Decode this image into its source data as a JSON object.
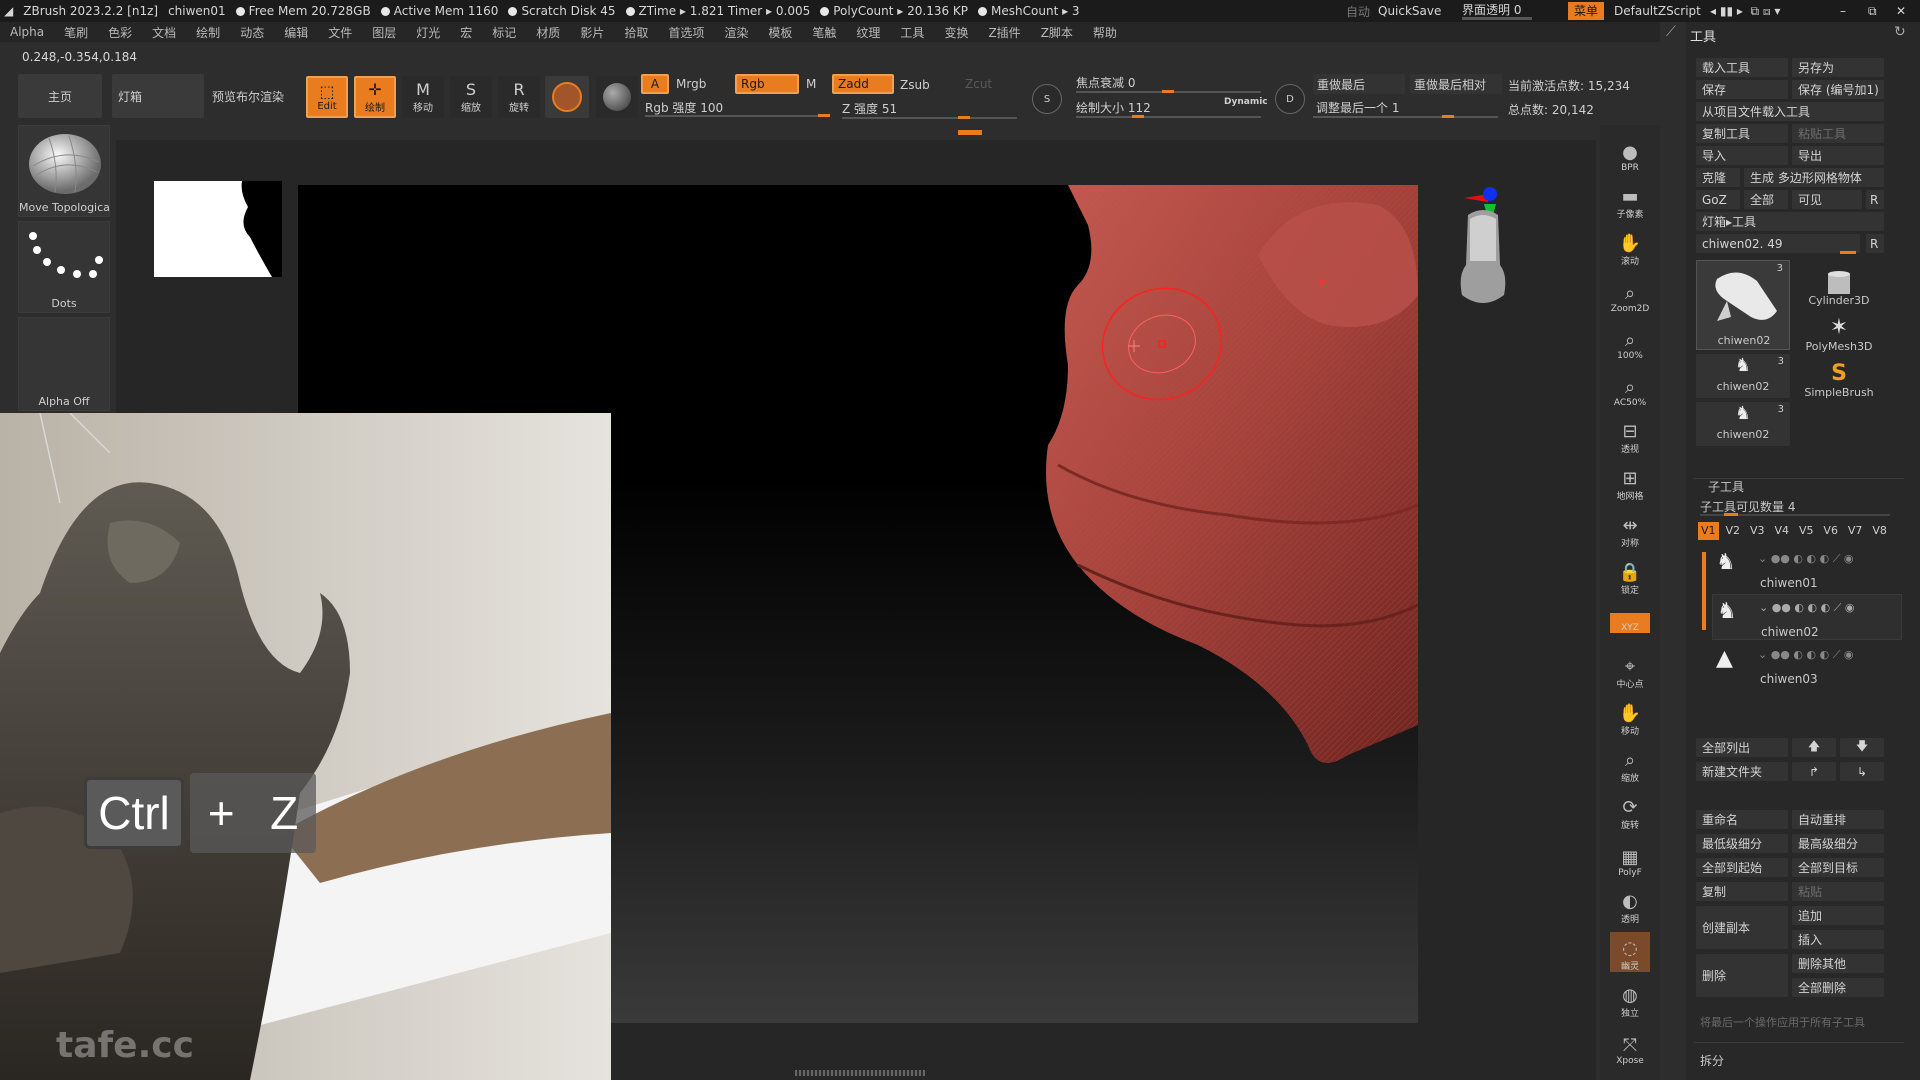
{
  "titlebar": {
    "app": "ZBrush 2023.2.2 [n1z]",
    "document": "chiwen01",
    "free_mem": "Free Mem 20.728GB",
    "active_mem": "Active Mem 1160",
    "scratch": "Scratch Disk 45",
    "ztime": "ZTime ▸ 1.821 Timer ▸ 0.005",
    "polycount": "PolyCount ▸ 20.136 KP",
    "meshcount": "MeshCount ▸ 3",
    "auto": "自动",
    "quicksave": "QuickSave",
    "ui_transparency": "界面透明 0",
    "menu_btn": "菜单",
    "zscript": "DefaultZScript"
  },
  "menubar": [
    "Alpha",
    "笔刷",
    "色彩",
    "文档",
    "绘制",
    "动态",
    "编辑",
    "文件",
    "图层",
    "灯光",
    "宏",
    "标记",
    "材质",
    "影片",
    "拾取",
    "首选项",
    "渲染",
    "模板",
    "笔触",
    "纹理",
    "工具",
    "变换",
    "Z插件",
    "Z脚本",
    "帮助"
  ],
  "coords": "0.248,-0.354,0.184",
  "toolbar": {
    "home": "主页",
    "lightbox": "灯箱",
    "bpr_preview": "预览布尔渲染",
    "edit": "Edit",
    "draw": "绘制",
    "move": "移动",
    "scale": "缩放",
    "rotate": "旋转",
    "a_btn": "A",
    "mrgb": "Mrgb",
    "rgb": "Rgb",
    "m": "M",
    "zadd": "Zadd",
    "zsub": "Zsub",
    "zcut": "Zcut",
    "rgb_intensity": "Rgb 强度 100",
    "z_intensity": "Z 强度 51",
    "focal_shift": "焦点衰减 0",
    "draw_size": "绘制大小 112",
    "dynamic": "Dynamic",
    "replay_last": "重做最后",
    "replay_last_rel": "重做最后相对",
    "adjust_last": "调整最后一个 1",
    "active_points": "当前激活点数: 15,234",
    "total_points": "总点数: 20,142"
  },
  "left_panel": {
    "brush": "Move Topologica",
    "stroke": "Dots",
    "alpha": "Alpha Off"
  },
  "photo_overlay": {
    "key1": "Ctrl",
    "plus": "+",
    "key2": "Z",
    "watermark": "tafe.cc"
  },
  "right_strip": [
    {
      "label": "BPR",
      "icon": "bpr-icon"
    },
    {
      "label": "子像素",
      "icon": "subpixel-icon"
    },
    {
      "label": "滚动",
      "icon": "scroll-icon"
    },
    {
      "label": "Zoom2D",
      "icon": "zoom2d-icon"
    },
    {
      "label": "100%",
      "icon": "zoom100-icon"
    },
    {
      "label": "AC50%",
      "icon": "ac50-icon"
    },
    {
      "label": "透视",
      "icon": "perspective-icon"
    },
    {
      "label": "地网格",
      "icon": "floor-grid-icon"
    },
    {
      "label": "对称",
      "icon": "symmetry-icon"
    },
    {
      "label": "锁定",
      "icon": "lock-icon"
    },
    {
      "label": "XYZ",
      "icon": "xyz-icon"
    },
    {
      "label": "中心点",
      "icon": "center-point-icon"
    },
    {
      "label": "移动",
      "icon": "move-view-icon"
    },
    {
      "label": "缩放",
      "icon": "scale-view-icon"
    },
    {
      "label": "旋转",
      "icon": "rotate-view-icon"
    },
    {
      "label": "PolyF",
      "icon": "polyframe-icon"
    },
    {
      "label": "透明",
      "icon": "transparent-icon"
    },
    {
      "label": "幽灵",
      "icon": "ghost-icon"
    },
    {
      "label": "独立",
      "icon": "solo-icon"
    },
    {
      "label": "Xpose",
      "icon": "xpose-icon"
    }
  ],
  "tool_panel": {
    "title": "工具",
    "load_tool": "载入工具",
    "save_as": "另存为",
    "save": "保存",
    "save_inc": "保存 (编号加1)",
    "load_from_project": "从项目文件载入工具",
    "copy_tool": "复制工具",
    "paste_tool": "粘贴工具",
    "import": "导入",
    "export": "导出",
    "clone": "克隆",
    "make_polymesh": "生成 多边形网格物体",
    "goz": "GoZ",
    "all": "全部",
    "visible": "可见",
    "r": "R",
    "lightbox_tools": "灯箱▸工具",
    "current_tool": "chiwen02. 49",
    "tools": [
      {
        "name": "chiwen02",
        "count": "3"
      },
      {
        "name": "Cylinder3D",
        "count": ""
      },
      {
        "name": "PolyMesh3D",
        "count": ""
      },
      {
        "name": "chiwen02",
        "count": "3"
      },
      {
        "name": "SimpleBrush",
        "count": ""
      },
      {
        "name": "chiwen02",
        "count": "3"
      }
    ],
    "subtool_title": "子工具",
    "visible_count": "子工具可见数量 4",
    "views": [
      "V1",
      "V2",
      "V3",
      "V4",
      "V5",
      "V6",
      "V7",
      "V8"
    ],
    "subtools": [
      "chiwen01",
      "chiwen02",
      "chiwen03"
    ],
    "list_all": "全部列出",
    "new_folder": "新建文件夹",
    "rename": "重命名",
    "auto_reorder": "自动重排",
    "lowest_subdiv": "最低级细分",
    "highest_subdiv": "最高级细分",
    "all_to_start": "全部到起始",
    "all_to_target": "全部到目标",
    "duplicate": "复制",
    "paste": "粘贴",
    "create_copy": "创建副本",
    "append": "追加",
    "insert": "插入",
    "delete": "删除",
    "delete_other": "删除其他",
    "delete_all": "全部删除",
    "apply_last": "将最后一个操作应用于所有子工具",
    "split": "拆分"
  },
  "colors": {
    "accent": "#e87c1e",
    "model": "#9a3a33",
    "panel": "#282828"
  }
}
